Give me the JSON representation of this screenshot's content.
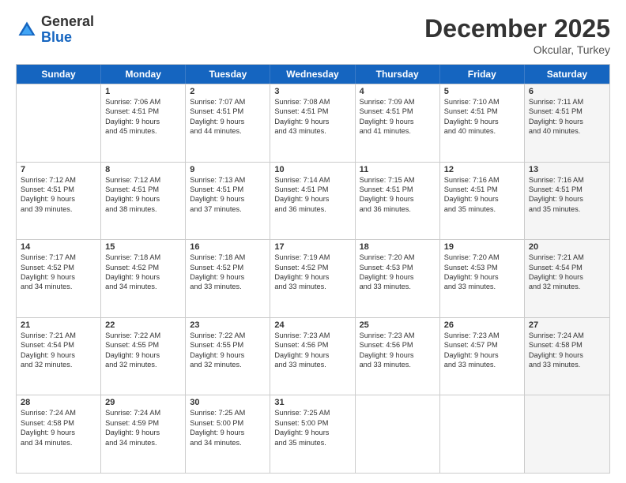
{
  "logo": {
    "general": "General",
    "blue": "Blue"
  },
  "title": "December 2025",
  "subtitle": "Okcular, Turkey",
  "headers": [
    "Sunday",
    "Monday",
    "Tuesday",
    "Wednesday",
    "Thursday",
    "Friday",
    "Saturday"
  ],
  "weeks": [
    [
      {
        "day": "",
        "lines": [],
        "shaded": false
      },
      {
        "day": "1",
        "lines": [
          "Sunrise: 7:06 AM",
          "Sunset: 4:51 PM",
          "Daylight: 9 hours",
          "and 45 minutes."
        ],
        "shaded": false
      },
      {
        "day": "2",
        "lines": [
          "Sunrise: 7:07 AM",
          "Sunset: 4:51 PM",
          "Daylight: 9 hours",
          "and 44 minutes."
        ],
        "shaded": false
      },
      {
        "day": "3",
        "lines": [
          "Sunrise: 7:08 AM",
          "Sunset: 4:51 PM",
          "Daylight: 9 hours",
          "and 43 minutes."
        ],
        "shaded": false
      },
      {
        "day": "4",
        "lines": [
          "Sunrise: 7:09 AM",
          "Sunset: 4:51 PM",
          "Daylight: 9 hours",
          "and 41 minutes."
        ],
        "shaded": false
      },
      {
        "day": "5",
        "lines": [
          "Sunrise: 7:10 AM",
          "Sunset: 4:51 PM",
          "Daylight: 9 hours",
          "and 40 minutes."
        ],
        "shaded": false
      },
      {
        "day": "6",
        "lines": [
          "Sunrise: 7:11 AM",
          "Sunset: 4:51 PM",
          "Daylight: 9 hours",
          "and 40 minutes."
        ],
        "shaded": true
      }
    ],
    [
      {
        "day": "7",
        "lines": [
          "Sunrise: 7:12 AM",
          "Sunset: 4:51 PM",
          "Daylight: 9 hours",
          "and 39 minutes."
        ],
        "shaded": false
      },
      {
        "day": "8",
        "lines": [
          "Sunrise: 7:12 AM",
          "Sunset: 4:51 PM",
          "Daylight: 9 hours",
          "and 38 minutes."
        ],
        "shaded": false
      },
      {
        "day": "9",
        "lines": [
          "Sunrise: 7:13 AM",
          "Sunset: 4:51 PM",
          "Daylight: 9 hours",
          "and 37 minutes."
        ],
        "shaded": false
      },
      {
        "day": "10",
        "lines": [
          "Sunrise: 7:14 AM",
          "Sunset: 4:51 PM",
          "Daylight: 9 hours",
          "and 36 minutes."
        ],
        "shaded": false
      },
      {
        "day": "11",
        "lines": [
          "Sunrise: 7:15 AM",
          "Sunset: 4:51 PM",
          "Daylight: 9 hours",
          "and 36 minutes."
        ],
        "shaded": false
      },
      {
        "day": "12",
        "lines": [
          "Sunrise: 7:16 AM",
          "Sunset: 4:51 PM",
          "Daylight: 9 hours",
          "and 35 minutes."
        ],
        "shaded": false
      },
      {
        "day": "13",
        "lines": [
          "Sunrise: 7:16 AM",
          "Sunset: 4:51 PM",
          "Daylight: 9 hours",
          "and 35 minutes."
        ],
        "shaded": true
      }
    ],
    [
      {
        "day": "14",
        "lines": [
          "Sunrise: 7:17 AM",
          "Sunset: 4:52 PM",
          "Daylight: 9 hours",
          "and 34 minutes."
        ],
        "shaded": false
      },
      {
        "day": "15",
        "lines": [
          "Sunrise: 7:18 AM",
          "Sunset: 4:52 PM",
          "Daylight: 9 hours",
          "and 34 minutes."
        ],
        "shaded": false
      },
      {
        "day": "16",
        "lines": [
          "Sunrise: 7:18 AM",
          "Sunset: 4:52 PM",
          "Daylight: 9 hours",
          "and 33 minutes."
        ],
        "shaded": false
      },
      {
        "day": "17",
        "lines": [
          "Sunrise: 7:19 AM",
          "Sunset: 4:52 PM",
          "Daylight: 9 hours",
          "and 33 minutes."
        ],
        "shaded": false
      },
      {
        "day": "18",
        "lines": [
          "Sunrise: 7:20 AM",
          "Sunset: 4:53 PM",
          "Daylight: 9 hours",
          "and 33 minutes."
        ],
        "shaded": false
      },
      {
        "day": "19",
        "lines": [
          "Sunrise: 7:20 AM",
          "Sunset: 4:53 PM",
          "Daylight: 9 hours",
          "and 33 minutes."
        ],
        "shaded": false
      },
      {
        "day": "20",
        "lines": [
          "Sunrise: 7:21 AM",
          "Sunset: 4:54 PM",
          "Daylight: 9 hours",
          "and 32 minutes."
        ],
        "shaded": true
      }
    ],
    [
      {
        "day": "21",
        "lines": [
          "Sunrise: 7:21 AM",
          "Sunset: 4:54 PM",
          "Daylight: 9 hours",
          "and 32 minutes."
        ],
        "shaded": false
      },
      {
        "day": "22",
        "lines": [
          "Sunrise: 7:22 AM",
          "Sunset: 4:55 PM",
          "Daylight: 9 hours",
          "and 32 minutes."
        ],
        "shaded": false
      },
      {
        "day": "23",
        "lines": [
          "Sunrise: 7:22 AM",
          "Sunset: 4:55 PM",
          "Daylight: 9 hours",
          "and 32 minutes."
        ],
        "shaded": false
      },
      {
        "day": "24",
        "lines": [
          "Sunrise: 7:23 AM",
          "Sunset: 4:56 PM",
          "Daylight: 9 hours",
          "and 33 minutes."
        ],
        "shaded": false
      },
      {
        "day": "25",
        "lines": [
          "Sunrise: 7:23 AM",
          "Sunset: 4:56 PM",
          "Daylight: 9 hours",
          "and 33 minutes."
        ],
        "shaded": false
      },
      {
        "day": "26",
        "lines": [
          "Sunrise: 7:23 AM",
          "Sunset: 4:57 PM",
          "Daylight: 9 hours",
          "and 33 minutes."
        ],
        "shaded": false
      },
      {
        "day": "27",
        "lines": [
          "Sunrise: 7:24 AM",
          "Sunset: 4:58 PM",
          "Daylight: 9 hours",
          "and 33 minutes."
        ],
        "shaded": true
      }
    ],
    [
      {
        "day": "28",
        "lines": [
          "Sunrise: 7:24 AM",
          "Sunset: 4:58 PM",
          "Daylight: 9 hours",
          "and 34 minutes."
        ],
        "shaded": false
      },
      {
        "day": "29",
        "lines": [
          "Sunrise: 7:24 AM",
          "Sunset: 4:59 PM",
          "Daylight: 9 hours",
          "and 34 minutes."
        ],
        "shaded": false
      },
      {
        "day": "30",
        "lines": [
          "Sunrise: 7:25 AM",
          "Sunset: 5:00 PM",
          "Daylight: 9 hours",
          "and 34 minutes."
        ],
        "shaded": false
      },
      {
        "day": "31",
        "lines": [
          "Sunrise: 7:25 AM",
          "Sunset: 5:00 PM",
          "Daylight: 9 hours",
          "and 35 minutes."
        ],
        "shaded": false
      },
      {
        "day": "",
        "lines": [],
        "shaded": false
      },
      {
        "day": "",
        "lines": [],
        "shaded": false
      },
      {
        "day": "",
        "lines": [],
        "shaded": true
      }
    ]
  ]
}
